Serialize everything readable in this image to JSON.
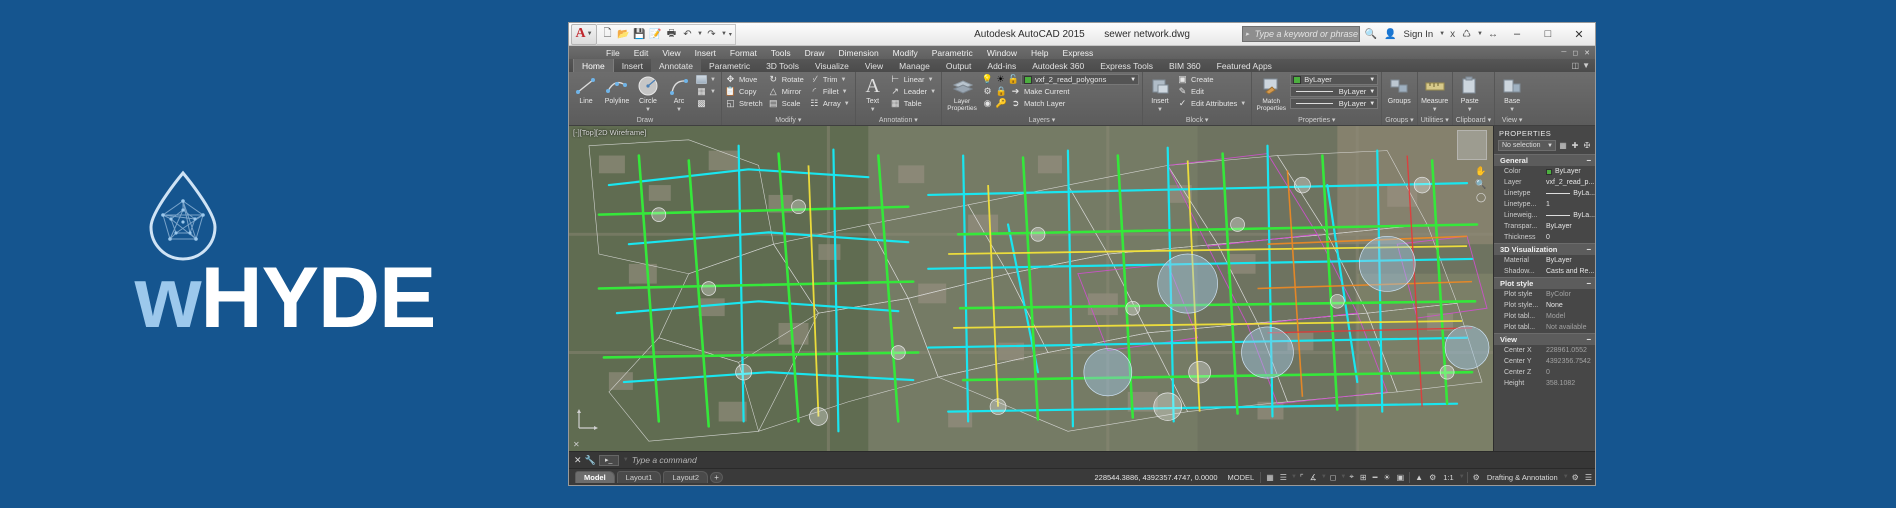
{
  "brand": {
    "word_first": "w",
    "word_rest": "HYDE",
    "logo_icon": "water-drop-network-icon",
    "bg_color": "#15558f",
    "accent_color": "#9cc8ec"
  },
  "window": {
    "app_title": "Autodesk AutoCAD 2015",
    "file_name": "sewer network.dwg",
    "search_placeholder": "Type a keyword or phrase",
    "sign_in_label": "Sign In",
    "minimize_label": "–",
    "maximize_label": "□",
    "close_label": "✕",
    "app_menu_label": "A"
  },
  "quick_access": [
    {
      "name": "new-icon",
      "glyph": "□"
    },
    {
      "name": "open-icon",
      "glyph": "▷"
    },
    {
      "name": "save-icon",
      "glyph": "▣"
    },
    {
      "name": "save-as-icon",
      "glyph": "▤"
    },
    {
      "name": "plot-icon",
      "glyph": "⎙"
    },
    {
      "name": "undo-icon",
      "glyph": "↶"
    },
    {
      "name": "redo-icon",
      "glyph": "↷"
    }
  ],
  "menubar": [
    "File",
    "Edit",
    "View",
    "Insert",
    "Format",
    "Tools",
    "Draw",
    "Dimension",
    "Modify",
    "Parametric",
    "Window",
    "Help",
    "Express"
  ],
  "ribbon_tabs": [
    {
      "label": "Home",
      "state": "active"
    },
    {
      "label": "Insert",
      "state": "normal"
    },
    {
      "label": "Annotate",
      "state": "hl"
    },
    {
      "label": "Parametric",
      "state": "normal"
    },
    {
      "label": "3D Tools",
      "state": "normal"
    },
    {
      "label": "Visualize",
      "state": "normal"
    },
    {
      "label": "View",
      "state": "normal"
    },
    {
      "label": "Manage",
      "state": "normal"
    },
    {
      "label": "Output",
      "state": "normal"
    },
    {
      "label": "Add-ins",
      "state": "normal"
    },
    {
      "label": "Autodesk 360",
      "state": "normal"
    },
    {
      "label": "Express Tools",
      "state": "normal"
    },
    {
      "label": "BIM 360",
      "state": "normal"
    },
    {
      "label": "Featured Apps",
      "state": "normal"
    }
  ],
  "ribbon": {
    "draw": {
      "title": "Draw",
      "buttons": [
        {
          "label": "Line",
          "icon": "line-icon"
        },
        {
          "label": "Polyline",
          "icon": "polyline-icon"
        },
        {
          "label": "Circle",
          "icon": "circle-icon"
        },
        {
          "label": "Arc",
          "icon": "arc-icon"
        }
      ]
    },
    "modify": {
      "title": "Modify",
      "buttons": [
        {
          "label": "Move",
          "icon": "move-icon"
        },
        {
          "label": "Rotate",
          "icon": "rotate-icon"
        },
        {
          "label": "Trim",
          "icon": "trim-icon"
        },
        {
          "label": "Copy",
          "icon": "copy-icon"
        },
        {
          "label": "Mirror",
          "icon": "mirror-icon"
        },
        {
          "label": "Fillet",
          "icon": "fillet-icon"
        },
        {
          "label": "Stretch",
          "icon": "stretch-icon"
        },
        {
          "label": "Scale",
          "icon": "scale-icon"
        },
        {
          "label": "Array",
          "icon": "array-icon"
        }
      ]
    },
    "annotation": {
      "title": "Annotation",
      "big": {
        "label": "Text",
        "icon": "text-icon"
      },
      "buttons": [
        {
          "label": "Linear",
          "icon": "linear-dimension-icon"
        },
        {
          "label": "Leader",
          "icon": "leader-icon"
        },
        {
          "label": "Table",
          "icon": "table-icon"
        }
      ]
    },
    "layers": {
      "title": "Layers",
      "big": {
        "label": "Layer\nProperties",
        "icon": "layer-properties-icon"
      },
      "current_layer": "vxf_2_read_polygons",
      "current_layer_color": "#4caf3f",
      "buttons": [
        {
          "label": "Make Current",
          "icon": "make-current-icon"
        },
        {
          "label": "Match Layer",
          "icon": "match-layer-icon"
        }
      ]
    },
    "block": {
      "title": "Block",
      "big": {
        "label": "Insert",
        "icon": "insert-block-icon"
      },
      "buttons": [
        {
          "label": "Create",
          "icon": "create-block-icon"
        },
        {
          "label": "Edit",
          "icon": "edit-block-icon"
        },
        {
          "label": "Edit Attributes",
          "icon": "edit-attributes-icon"
        }
      ]
    },
    "properties": {
      "title": "Properties",
      "big": {
        "label": "Match\nProperties",
        "icon": "match-properties-icon"
      },
      "combos": [
        {
          "label": "ByLayer",
          "type": "color",
          "swatch": "#4caf3f"
        },
        {
          "label": "ByLayer",
          "type": "linetype"
        },
        {
          "label": "ByLayer",
          "type": "lineweight"
        }
      ]
    },
    "groups": {
      "title": "Groups",
      "label": "Groups",
      "icon": "groups-icon"
    },
    "utilities": {
      "title": "Utilities",
      "label": "Measure",
      "icon": "measure-icon"
    },
    "clipboard": {
      "title": "Clipboard",
      "label": "Paste",
      "icon": "paste-icon"
    },
    "view": {
      "title": "View",
      "label": "Base",
      "icon": "base-view-icon"
    }
  },
  "viewport": {
    "label": "[-][Top][2D Wireframe]",
    "ucs_icon": "ucs-axes-icon",
    "viewcube_icon": "view-cube-icon"
  },
  "properties_palette": {
    "title": "PROPERTIES",
    "selection": "No selection",
    "toolbar_icons": [
      "quick-select-icon",
      "crosshair-select-icon",
      "pickadd-icon"
    ],
    "sections": [
      {
        "name": "General",
        "rows": [
          {
            "key": "Color",
            "value": "ByLayer",
            "kind": "color",
            "swatch": "#4caf3f"
          },
          {
            "key": "Layer",
            "value": "vxf_2_read_p...",
            "kind": "text"
          },
          {
            "key": "Linetype",
            "value": "ByLa...",
            "kind": "line"
          },
          {
            "key": "Linetype...",
            "value": "1",
            "kind": "text"
          },
          {
            "key": "Lineweig...",
            "value": "ByLa...",
            "kind": "line"
          },
          {
            "key": "Transpar...",
            "value": "ByLayer",
            "kind": "text"
          },
          {
            "key": "Thickness",
            "value": "0",
            "kind": "text"
          }
        ]
      },
      {
        "name": "3D Visualization",
        "rows": [
          {
            "key": "Material",
            "value": "ByLayer",
            "kind": "text"
          },
          {
            "key": "Shadow...",
            "value": "Casts and Re...",
            "kind": "text"
          }
        ]
      },
      {
        "name": "Plot style",
        "rows": [
          {
            "key": "Plot style",
            "value": "ByColor",
            "kind": "dim"
          },
          {
            "key": "Plot style...",
            "value": "None",
            "kind": "text"
          },
          {
            "key": "Plot tabl...",
            "value": "Model",
            "kind": "dim"
          },
          {
            "key": "Plot tabl...",
            "value": "Not available",
            "kind": "dim"
          }
        ]
      },
      {
        "name": "View",
        "rows": [
          {
            "key": "Center X",
            "value": "228961.0552",
            "kind": "dim"
          },
          {
            "key": "Center Y",
            "value": "4392356.7542",
            "kind": "dim"
          },
          {
            "key": "Center Z",
            "value": "0",
            "kind": "dim"
          },
          {
            "key": "Height",
            "value": "358.1082",
            "kind": "dim"
          }
        ]
      }
    ]
  },
  "command_line": {
    "close_icon": "close-icon",
    "wrench_icon": "wrench-icon",
    "prompt_icon": "command-prompt-icon",
    "placeholder": "Type a command"
  },
  "status_bar": {
    "tabs": [
      {
        "label": "Model",
        "active": true
      },
      {
        "label": "Layout1",
        "active": false
      },
      {
        "label": "Layout2",
        "active": false
      }
    ],
    "add_tab_label": "+",
    "coordinates": "228544.3886, 4392357.4747, 0.0000",
    "space_label": "MODEL",
    "scale_label": "1:1",
    "workspace_label": "Drafting & Annotation",
    "icons": [
      "grid-icon",
      "snap-icon",
      "dropdown-icon",
      "ortho-icon",
      "polar-icon",
      "osnap-icon",
      "otrack-icon",
      "lineweight-icon",
      "transparency-icon",
      "quickprops-icon",
      "selectioncycling-icon",
      "annotation-scale-icon",
      "gear-icon",
      "hardware-accel-icon",
      "customization-icon"
    ]
  }
}
